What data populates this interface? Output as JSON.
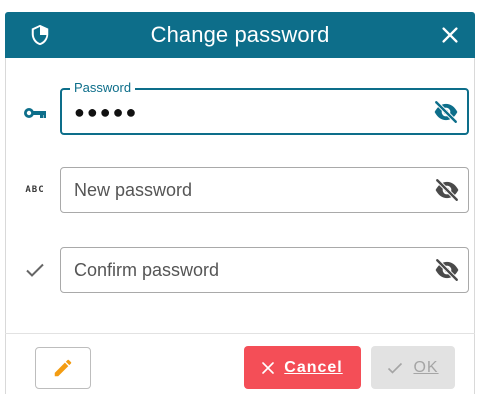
{
  "dialog": {
    "title": "Change password",
    "shield_icon": "shield-icon",
    "close_icon": "close-icon"
  },
  "fields": {
    "password": {
      "label": "Password",
      "value": "●●●●●",
      "lead_icon": "key-icon",
      "toggle_icon": "visibility-off-icon"
    },
    "new_password": {
      "placeholder": "New password",
      "lead_icon": "abc-icon",
      "lead_text": "ABC",
      "toggle_icon": "visibility-off-icon"
    },
    "confirm_password": {
      "placeholder": "Confirm password",
      "lead_icon": "check-icon",
      "toggle_icon": "visibility-off-icon"
    }
  },
  "actions": {
    "edit_icon": "pencil-icon",
    "cancel_label": "Cancel",
    "cancel_icon": "close-icon",
    "ok_label": "OK",
    "ok_icon": "check-icon"
  },
  "colors": {
    "accent": "#0d6e8a",
    "cancel": "#f44e57",
    "disabled": "#e2e2e2",
    "edit_icon": "#f39c12"
  }
}
